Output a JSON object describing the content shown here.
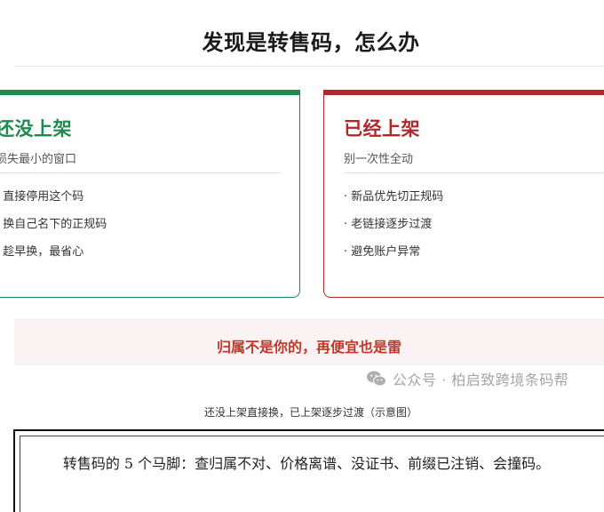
{
  "title": "发现是转售码，怎么办",
  "cards": {
    "left": {
      "heading": "还没上架",
      "subtitle": "损失最小的窗口",
      "items": [
        "· 直接停用这个码",
        "· 换自己名下的正规码",
        "· 趁早换，最省心"
      ],
      "accent_color": "#1f8a4c"
    },
    "right": {
      "heading": "已经上架",
      "subtitle": "别一次性全动",
      "items": [
        "· 新品优先切正规码",
        "· 老链接逐步过渡",
        "· 避免账户异常"
      ],
      "accent_color": "#b0282b"
    }
  },
  "banner": {
    "text": "归属不是你的，再便宜也是雷"
  },
  "watermark": {
    "icon": "wechat-icon",
    "text": "公众号 · 柏启致跨境条码帮"
  },
  "caption": "还没上架直接换，已上架逐步过渡（示意图）",
  "note": "转售码的 5 个马脚：查归属不对、价格离谱、没证书、前缀已注销、会撞码。"
}
